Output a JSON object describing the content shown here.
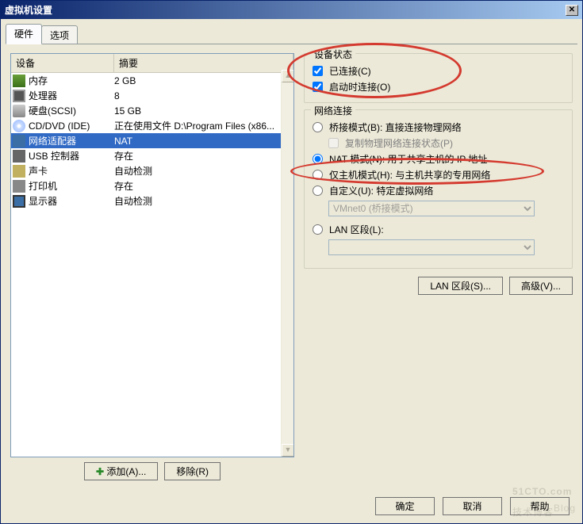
{
  "window": {
    "title": "虚拟机设置"
  },
  "tabs": {
    "hardware": "硬件",
    "options": "选项"
  },
  "list": {
    "col_device": "设备",
    "col_summary": "摘要",
    "rows": [
      {
        "name": "内存",
        "summary": "2 GB",
        "icon": "mem"
      },
      {
        "name": "处理器",
        "summary": "8",
        "icon": "cpu"
      },
      {
        "name": "硬盘(SCSI)",
        "summary": "15 GB",
        "icon": "disk"
      },
      {
        "name": "CD/DVD (IDE)",
        "summary": "正在使用文件 D:\\Program Files (x86...",
        "icon": "cd"
      },
      {
        "name": "网络适配器",
        "summary": "NAT",
        "icon": "net",
        "selected": true
      },
      {
        "name": "USB 控制器",
        "summary": "存在",
        "icon": "usb"
      },
      {
        "name": "声卡",
        "summary": "自动检测",
        "icon": "snd"
      },
      {
        "name": "打印机",
        "summary": "存在",
        "icon": "prn"
      },
      {
        "name": "显示器",
        "summary": "自动检测",
        "icon": "mon"
      }
    ]
  },
  "left_buttons": {
    "add": "添加(A)...",
    "remove": "移除(R)"
  },
  "device_status": {
    "title": "设备状态",
    "connected": "已连接(C)",
    "connect_on_power": "启动时连接(O)"
  },
  "net_conn": {
    "title": "网络连接",
    "bridged": "桥接模式(B): 直接连接物理网络",
    "replicate": "复制物理网络连接状态(P)",
    "nat": "NAT 模式(N): 用于共享主机的 IP 地址",
    "hostonly": "仅主机模式(H): 与主机共享的专用网络",
    "custom": "自定义(U): 特定虚拟网络",
    "vmnet_value": "VMnet0 (桥接模式)",
    "lanseg": "LAN 区段(L):"
  },
  "right_buttons": {
    "lanseg": "LAN 区段(S)...",
    "advanced": "高级(V)..."
  },
  "footer": {
    "ok": "确定",
    "cancel": "取消",
    "help": "帮助"
  },
  "watermark": "51CTO.com"
}
